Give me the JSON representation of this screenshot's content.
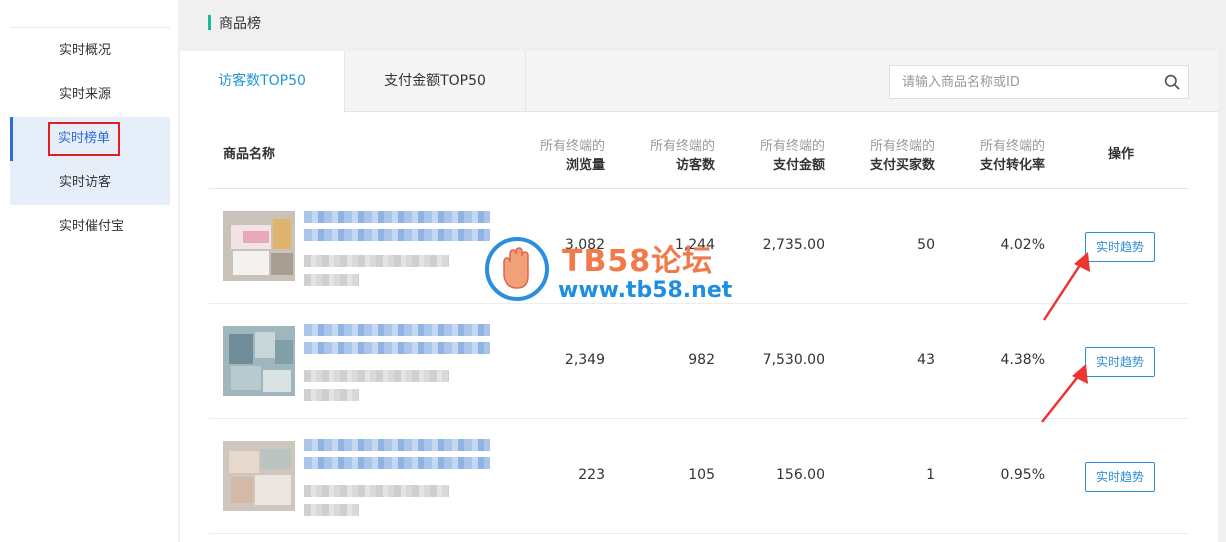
{
  "sidebar": {
    "items": [
      {
        "label": "实时概况"
      },
      {
        "label": "实时来源"
      },
      {
        "label": "实时榜单"
      },
      {
        "label": "实时访客"
      },
      {
        "label": "实时催付宝"
      }
    ]
  },
  "header": {
    "title": "商品榜"
  },
  "tabs": [
    {
      "label": "访客数TOP50"
    },
    {
      "label": "支付金额TOP50"
    }
  ],
  "search": {
    "placeholder": "请输入商品名称或ID"
  },
  "table": {
    "headers": {
      "name": "商品名称",
      "views": {
        "sub": "所有终端的",
        "main": "浏览量"
      },
      "visitors": {
        "sub": "所有终端的",
        "main": "访客数"
      },
      "amount": {
        "sub": "所有终端的",
        "main": "支付金额"
      },
      "buyers": {
        "sub": "所有终端的",
        "main": "支付买家数"
      },
      "rate": {
        "sub": "所有终端的",
        "main": "支付转化率"
      },
      "op": "操作"
    },
    "rows": [
      {
        "views": "3,082",
        "visitors": "1,244",
        "amount": "2,735.00",
        "buyers": "50",
        "rate": "4.02%",
        "action": "实时趋势"
      },
      {
        "views": "2,349",
        "visitors": "982",
        "amount": "7,530.00",
        "buyers": "43",
        "rate": "4.38%",
        "action": "实时趋势"
      },
      {
        "views": "223",
        "visitors": "105",
        "amount": "156.00",
        "buyers": "1",
        "rate": "0.95%",
        "action": "实时趋势"
      }
    ]
  },
  "watermark": {
    "title": "TB58论坛",
    "url": "www.tb58.net"
  },
  "colors": {
    "accent": "#2196d8",
    "header_bar": "#1db7a0",
    "highlight_border": "#e02020",
    "arrow": "#ee3333"
  }
}
